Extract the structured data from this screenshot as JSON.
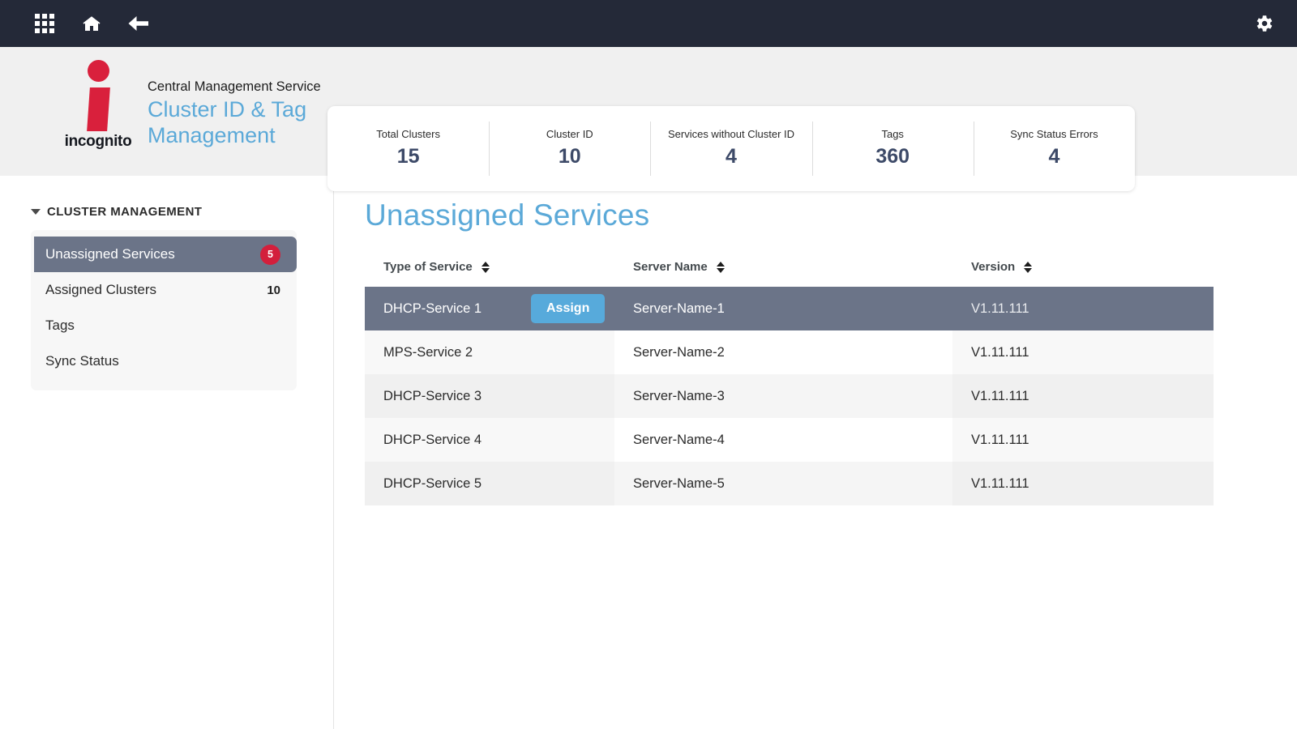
{
  "topnav": {
    "icons": [
      {
        "name": "apps-grid-icon",
        "glyph": "grid"
      },
      {
        "name": "home-icon",
        "glyph": "home"
      },
      {
        "name": "back-arrow-icon",
        "glyph": "arrow-left"
      }
    ],
    "settings_icon": "gear-icon"
  },
  "brand": {
    "logo_word": "incognito",
    "product": "Central Management Service",
    "page": "Cluster ID & Tag Management"
  },
  "kpis": [
    {
      "label": "Total Clusters",
      "value": "15"
    },
    {
      "label": "Cluster ID",
      "value": "10"
    },
    {
      "label": "Services without Cluster ID",
      "value": "4"
    },
    {
      "label": "Tags",
      "value": "360"
    },
    {
      "label": "Sync Status Errors",
      "value": "4"
    }
  ],
  "sidebar": {
    "section_label": "CLUSTER MANAGEMENT",
    "items": [
      {
        "label": "Unassigned Services",
        "badge": "5",
        "selected": true
      },
      {
        "label": "Assigned Clusters",
        "count": "10",
        "selected": false
      },
      {
        "label": "Tags",
        "selected": false
      },
      {
        "label": "Sync Status",
        "selected": false
      }
    ]
  },
  "content": {
    "title": "Unassigned Services",
    "columns": [
      "Type of Service",
      "Server Name",
      "Version"
    ],
    "rows": [
      {
        "service": "DHCP-Service 1",
        "server": "Server-Name-1",
        "version": "V1.11.111",
        "selected": true,
        "action": "Assign"
      },
      {
        "service": "MPS-Service 2",
        "server": "Server-Name-2",
        "version": "V1.11.111",
        "selected": false
      },
      {
        "service": "DHCP-Service 3",
        "server": "Server-Name-3",
        "version": "V1.11.111",
        "selected": false
      },
      {
        "service": "DHCP-Service 4",
        "server": "Server-Name-4",
        "version": "V1.11.111",
        "selected": false
      },
      {
        "service": "DHCP-Service 5",
        "server": "Server-Name-5",
        "version": "V1.11.111",
        "selected": false
      }
    ]
  },
  "colors": {
    "navbar": "#242938",
    "accent_blue": "#5ba9d8",
    "brand_red": "#d9203c",
    "badge_red": "#d31f3c",
    "selected_row": "#6b7488",
    "kpi_value": "#3d4a68"
  }
}
